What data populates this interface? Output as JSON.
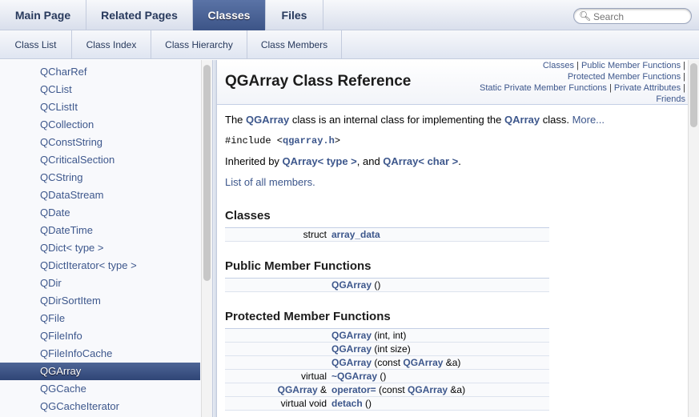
{
  "tabs": [
    {
      "label": "Main Page",
      "active": false
    },
    {
      "label": "Related Pages",
      "active": false
    },
    {
      "label": "Classes",
      "active": true
    },
    {
      "label": "Files",
      "active": false
    }
  ],
  "search": {
    "placeholder": "Search",
    "icon": "magnifier-icon"
  },
  "subtabs": [
    {
      "label": "Class List"
    },
    {
      "label": "Class Index"
    },
    {
      "label": "Class Hierarchy"
    },
    {
      "label": "Class Members"
    }
  ],
  "sidebar": {
    "items": [
      {
        "label": "QCharRef"
      },
      {
        "label": "QCList"
      },
      {
        "label": "QCListIt"
      },
      {
        "label": "QCollection"
      },
      {
        "label": "QConstString"
      },
      {
        "label": "QCriticalSection"
      },
      {
        "label": "QCString"
      },
      {
        "label": "QDataStream"
      },
      {
        "label": "QDate"
      },
      {
        "label": "QDateTime"
      },
      {
        "label": "QDict< type >"
      },
      {
        "label": "QDictIterator< type >"
      },
      {
        "label": "QDir"
      },
      {
        "label": "QDirSortItem"
      },
      {
        "label": "QFile"
      },
      {
        "label": "QFileInfo"
      },
      {
        "label": "QFileInfoCache"
      },
      {
        "label": "QGArray",
        "selected": true
      },
      {
        "label": "QGCache"
      },
      {
        "label": "QGCacheIterator"
      }
    ]
  },
  "header": {
    "title": "QGArray Class Reference",
    "summary": {
      "classes": "Classes",
      "public_member_functions": "Public Member Functions",
      "protected_member_functions": "Protected Member Functions",
      "static_private_member_functions": "Static Private Member Functions",
      "private_attributes": "Private Attributes",
      "friends": "Friends",
      "sep": " | "
    }
  },
  "intro": {
    "prefix": "The ",
    "class_link": "QGArray",
    "middle": " class is an internal class for implementing the ",
    "class_link2": "QArray",
    "suffix": " class. ",
    "more": "More..."
  },
  "include": {
    "prefix": "#include <",
    "file": "qgarray.h",
    "suffix": ">"
  },
  "inherited": {
    "prefix": "Inherited by ",
    "link1_name": "QArray",
    "link1_args": "< type >",
    "middle": ", and ",
    "link2_name": "QArray",
    "link2_args": "< char >",
    "suffix": "."
  },
  "list_all": "List of all members.",
  "sections": {
    "classes": {
      "title": "Classes",
      "rows": [
        {
          "left": "struct",
          "right_link": "array_data",
          "right_rest": ""
        }
      ]
    },
    "public": {
      "title": "Public Member Functions",
      "rows": [
        {
          "left": "",
          "right_link": "QGArray",
          "right_rest": " ()"
        }
      ]
    },
    "protected": {
      "title": "Protected Member Functions",
      "rows": [
        {
          "left": "",
          "right_link": "QGArray",
          "right_rest": " (int, int)"
        },
        {
          "left": "",
          "right_link": "QGArray",
          "right_rest": " (int size)"
        },
        {
          "left": "",
          "right_link": "QGArray",
          "right_rest": " (const ",
          "right_link2": "QGArray",
          "right_rest2": " &a)"
        },
        {
          "left": "virtual",
          "right_link": "~QGArray",
          "right_rest": " ()"
        },
        {
          "left_link": "QGArray",
          "left": " &",
          "right_link": "operator=",
          "right_rest": " (const ",
          "right_link2": "QGArray",
          "right_rest2": " &a)"
        },
        {
          "left": "virtual void",
          "right_link": "detach",
          "right_rest": " ()"
        }
      ]
    }
  }
}
